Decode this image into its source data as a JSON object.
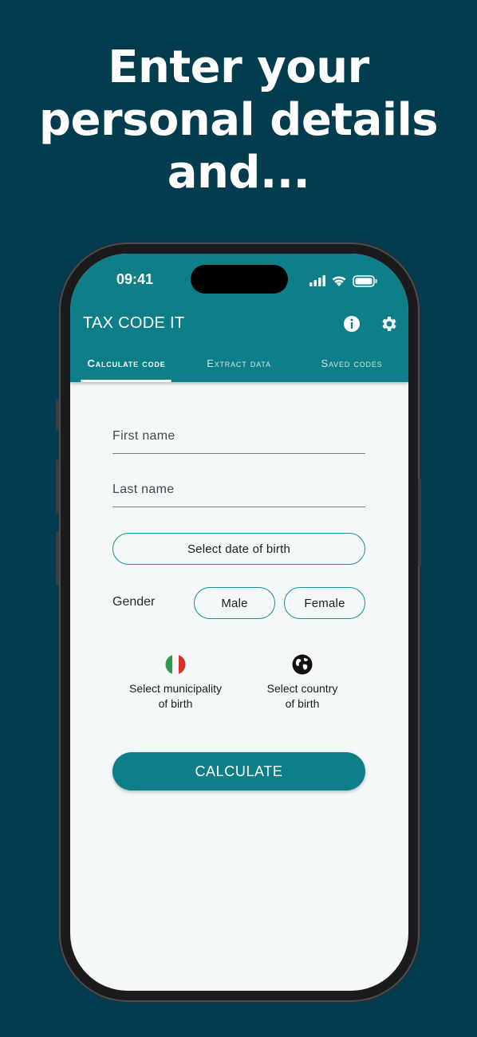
{
  "headline": [
    "Enter your",
    "personal details",
    "and..."
  ],
  "status": {
    "time": "09:41"
  },
  "app": {
    "title": "TAX CODE IT",
    "actions": [
      "info-icon",
      "gear-icon"
    ],
    "tabs": [
      {
        "label": "Calculate code",
        "active": true
      },
      {
        "label": "Extract data",
        "active": false
      },
      {
        "label": "Saved codes",
        "active": false
      }
    ]
  },
  "form": {
    "first_name": {
      "placeholder": "First name",
      "value": ""
    },
    "last_name": {
      "placeholder": "Last name",
      "value": ""
    },
    "dob_button": "Select date of birth",
    "gender_label": "Gender",
    "gender_options": [
      "Male",
      "Female"
    ],
    "municipality": {
      "icon": "italy-flag-icon",
      "line1": "Select municipality",
      "line2": "of birth"
    },
    "country": {
      "icon": "globe-icon",
      "line1": "Select country",
      "line2": "of birth"
    },
    "calculate_button": "CALCULATE"
  },
  "colors": {
    "background": "#033c4e",
    "accent": "#0e7f89",
    "screen": "#f4f8f9"
  }
}
